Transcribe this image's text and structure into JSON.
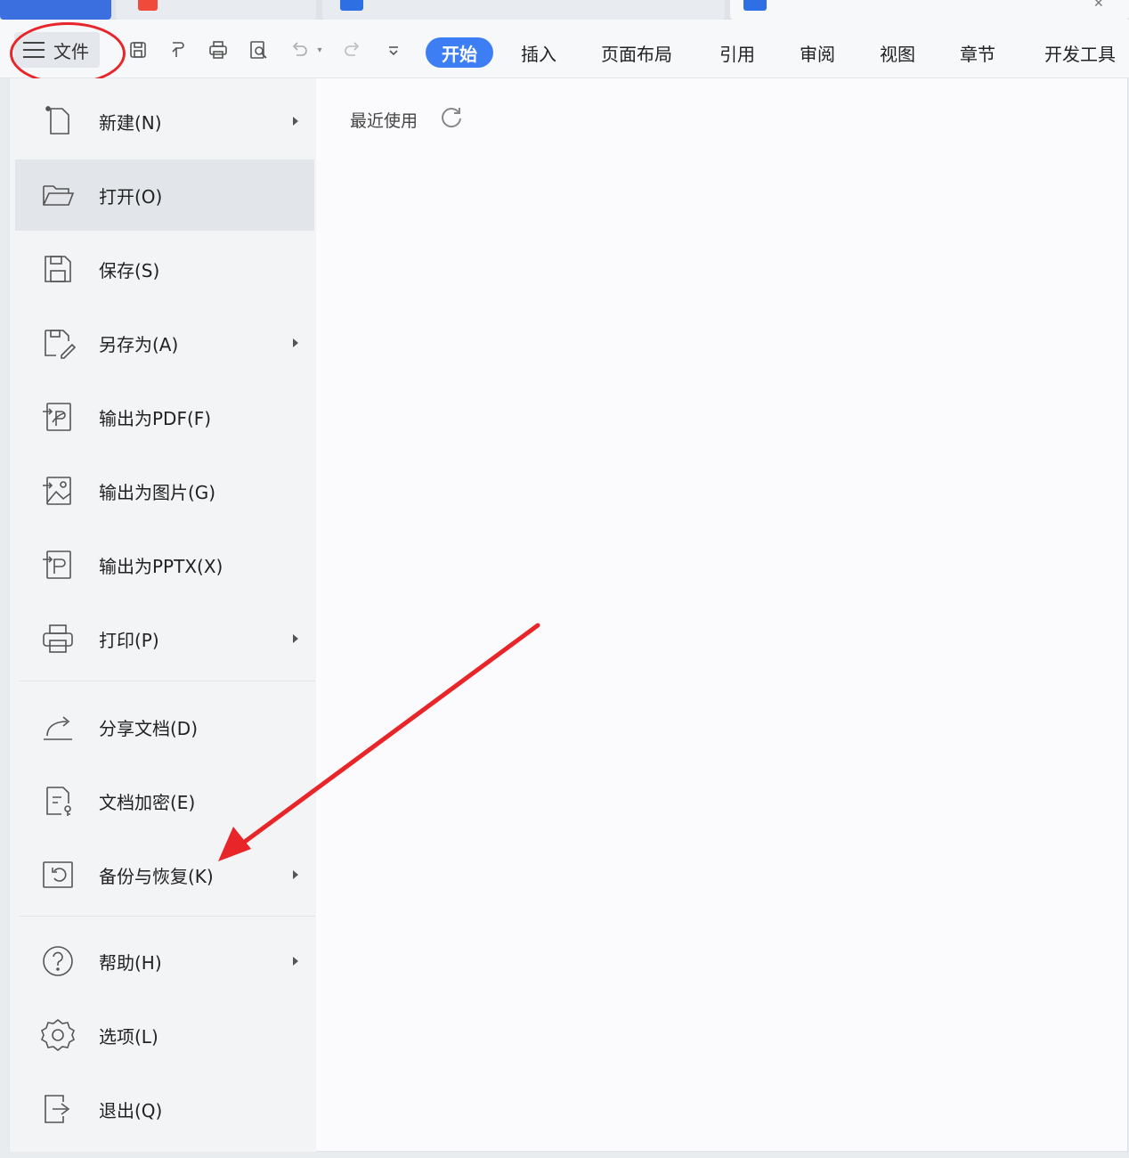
{
  "colors": {
    "accent": "#3d7ef5",
    "annotation_red": "#e8262a",
    "menu_bg": "#f3f4f6",
    "selected_bg": "#e2e5e9"
  },
  "toolbar": {
    "file_label": "文件",
    "quick_access": [
      "save-icon",
      "format-painter-icon",
      "print-icon",
      "print-preview-icon",
      "undo-icon",
      "redo-icon",
      "customize-icon"
    ],
    "tabs": [
      {
        "label": "开始",
        "active": true
      },
      {
        "label": "插入"
      },
      {
        "label": "页面布局"
      },
      {
        "label": "引用"
      },
      {
        "label": "审阅"
      },
      {
        "label": "视图"
      },
      {
        "label": "章节"
      },
      {
        "label": "开发工具"
      }
    ]
  },
  "menu": {
    "items": [
      {
        "label": "新建(N)",
        "icon": "new-document-icon",
        "submenu": true
      },
      {
        "label": "打开(O)",
        "icon": "open-folder-icon",
        "submenu": false,
        "selected": true
      },
      {
        "label": "保存(S)",
        "icon": "save-icon",
        "submenu": false
      },
      {
        "label": "另存为(A)",
        "icon": "save-as-icon",
        "submenu": true
      },
      {
        "label": "输出为PDF(F)",
        "icon": "export-pdf-icon",
        "submenu": false
      },
      {
        "label": "输出为图片(G)",
        "icon": "export-image-icon",
        "submenu": false
      },
      {
        "label": "输出为PPTX(X)",
        "icon": "export-pptx-icon",
        "submenu": false
      },
      {
        "label": "打印(P)",
        "icon": "print-icon",
        "submenu": true
      },
      {
        "label": "分享文档(D)",
        "icon": "share-icon",
        "submenu": false
      },
      {
        "label": "文档加密(E)",
        "icon": "encrypt-icon",
        "submenu": false
      },
      {
        "label": "备份与恢复(K)",
        "icon": "backup-restore-icon",
        "submenu": true
      },
      {
        "label": "帮助(H)",
        "icon": "help-icon",
        "submenu": true
      },
      {
        "label": "选项(L)",
        "icon": "options-gear-icon",
        "submenu": false
      },
      {
        "label": "退出(Q)",
        "icon": "exit-icon",
        "submenu": false
      }
    ]
  },
  "content": {
    "recent_label": "最近使用",
    "refresh_icon": "refresh-icon"
  }
}
